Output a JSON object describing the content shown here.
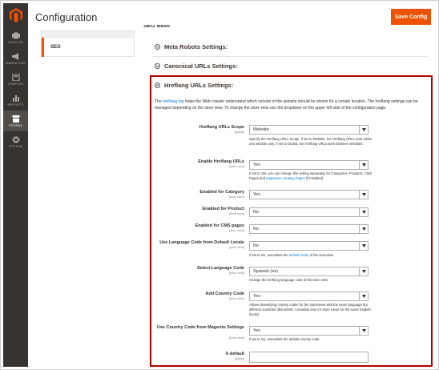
{
  "window": {
    "title": "Configuration"
  },
  "header": {
    "save_label": "Save Config"
  },
  "sidebar": {
    "logo_icon": "magento-logo-icon",
    "items": [
      {
        "label": "CATALOG",
        "icon": "catalog-icon",
        "active": false
      },
      {
        "label": "MARKETING",
        "icon": "marketing-icon",
        "active": false
      },
      {
        "label": "CONTENT",
        "icon": "content-icon",
        "active": false
      },
      {
        "label": "REPORTS",
        "icon": "reports-icon",
        "active": false
      },
      {
        "label": "STORES",
        "icon": "stores-icon",
        "active": true
      },
      {
        "label": "SYSTEM",
        "icon": "system-icon",
        "active": false
      }
    ]
  },
  "tabs": {
    "active": "SEO"
  },
  "sections": {
    "cut_title": "SEO Base",
    "meta_robots": "Meta Robots Settings:",
    "canonical": "Canonical URLs Settings:",
    "hreflang": "Hreflang URLs Settings:"
  },
  "intro": {
    "pre": "The ",
    "link": "hreflang tag",
    "post": " helps the Web crawler understand which version of the website should be shown for a certain location. The hreflang settings can be managed depending on the store view. To change the store view use the dropdown on the upper left side of the configuration page."
  },
  "fields": {
    "scope": {
      "label": "Hreflang URLs Scope",
      "scope": "[global]",
      "value": "Website",
      "note": "Specify the Hreflang URLs Scope. If set to Website, the Hreflang URLs work within one website only. If set to Global, the Hreflang URLs work between websites."
    },
    "enable": {
      "label": "Enable Hreflang URLs",
      "scope": "[store view]",
      "value": "Yes",
      "note_pre": "If set to Yes, you can change this setting separately for Categories, Products, CMS Pages and ",
      "note_link": "Mageworx Landing Pages",
      "note_post": " (if installed)."
    },
    "category": {
      "label": "Enabled for Category",
      "scope": "[store view]",
      "value": "Yes"
    },
    "product": {
      "label": "Enabled for Product",
      "scope": "[store view]",
      "value": "No"
    },
    "cms": {
      "label": "Enabled for CMS pages",
      "scope": "[store view]",
      "value": "No"
    },
    "locale": {
      "label": "Use Language Code from Default Locale",
      "scope": "[store view]",
      "value": "No",
      "note_pre": "If set to No, overwrites the ",
      "note_link": "default locale",
      "note_post": " of the storeview"
    },
    "language": {
      "label": "Select Language Code",
      "scope": "[store view]",
      "value": "Spanish (es)",
      "note": "Change the hreflang language code of the store view"
    },
    "country": {
      "label": "Add Country Code",
      "scope": "[store view]",
      "value": "Yes",
      "note": "Allows diversifying country codes for the storeviews with the same language but different countries (like British, Canadian and US store views for the same English locale)"
    },
    "magento_country": {
      "label": "Use Country Code from Magento Settings",
      "scope": "[store view]",
      "value": "Yes",
      "note": "If set to No, overwrites the default country code."
    },
    "xdefault": {
      "label": "X-default",
      "scope": "[global]",
      "value": ""
    }
  },
  "colors": {
    "accent": "#eb5202",
    "highlight": "#b50000",
    "link": "#007bdb",
    "sidebar": "#373330"
  }
}
